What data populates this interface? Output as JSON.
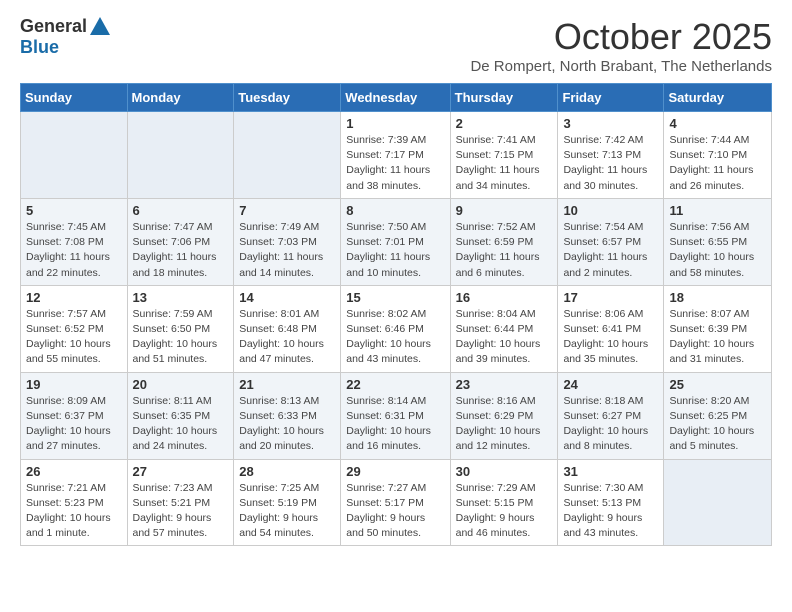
{
  "header": {
    "logo_general": "General",
    "logo_blue": "Blue",
    "month_title": "October 2025",
    "subtitle": "De Rompert, North Brabant, The Netherlands"
  },
  "weekdays": [
    "Sunday",
    "Monday",
    "Tuesday",
    "Wednesday",
    "Thursday",
    "Friday",
    "Saturday"
  ],
  "weeks": [
    [
      {
        "day": "",
        "info": ""
      },
      {
        "day": "",
        "info": ""
      },
      {
        "day": "",
        "info": ""
      },
      {
        "day": "1",
        "info": "Sunrise: 7:39 AM\nSunset: 7:17 PM\nDaylight: 11 hours\nand 38 minutes."
      },
      {
        "day": "2",
        "info": "Sunrise: 7:41 AM\nSunset: 7:15 PM\nDaylight: 11 hours\nand 34 minutes."
      },
      {
        "day": "3",
        "info": "Sunrise: 7:42 AM\nSunset: 7:13 PM\nDaylight: 11 hours\nand 30 minutes."
      },
      {
        "day": "4",
        "info": "Sunrise: 7:44 AM\nSunset: 7:10 PM\nDaylight: 11 hours\nand 26 minutes."
      }
    ],
    [
      {
        "day": "5",
        "info": "Sunrise: 7:45 AM\nSunset: 7:08 PM\nDaylight: 11 hours\nand 22 minutes."
      },
      {
        "day": "6",
        "info": "Sunrise: 7:47 AM\nSunset: 7:06 PM\nDaylight: 11 hours\nand 18 minutes."
      },
      {
        "day": "7",
        "info": "Sunrise: 7:49 AM\nSunset: 7:03 PM\nDaylight: 11 hours\nand 14 minutes."
      },
      {
        "day": "8",
        "info": "Sunrise: 7:50 AM\nSunset: 7:01 PM\nDaylight: 11 hours\nand 10 minutes."
      },
      {
        "day": "9",
        "info": "Sunrise: 7:52 AM\nSunset: 6:59 PM\nDaylight: 11 hours\nand 6 minutes."
      },
      {
        "day": "10",
        "info": "Sunrise: 7:54 AM\nSunset: 6:57 PM\nDaylight: 11 hours\nand 2 minutes."
      },
      {
        "day": "11",
        "info": "Sunrise: 7:56 AM\nSunset: 6:55 PM\nDaylight: 10 hours\nand 58 minutes."
      }
    ],
    [
      {
        "day": "12",
        "info": "Sunrise: 7:57 AM\nSunset: 6:52 PM\nDaylight: 10 hours\nand 55 minutes."
      },
      {
        "day": "13",
        "info": "Sunrise: 7:59 AM\nSunset: 6:50 PM\nDaylight: 10 hours\nand 51 minutes."
      },
      {
        "day": "14",
        "info": "Sunrise: 8:01 AM\nSunset: 6:48 PM\nDaylight: 10 hours\nand 47 minutes."
      },
      {
        "day": "15",
        "info": "Sunrise: 8:02 AM\nSunset: 6:46 PM\nDaylight: 10 hours\nand 43 minutes."
      },
      {
        "day": "16",
        "info": "Sunrise: 8:04 AM\nSunset: 6:44 PM\nDaylight: 10 hours\nand 39 minutes."
      },
      {
        "day": "17",
        "info": "Sunrise: 8:06 AM\nSunset: 6:41 PM\nDaylight: 10 hours\nand 35 minutes."
      },
      {
        "day": "18",
        "info": "Sunrise: 8:07 AM\nSunset: 6:39 PM\nDaylight: 10 hours\nand 31 minutes."
      }
    ],
    [
      {
        "day": "19",
        "info": "Sunrise: 8:09 AM\nSunset: 6:37 PM\nDaylight: 10 hours\nand 27 minutes."
      },
      {
        "day": "20",
        "info": "Sunrise: 8:11 AM\nSunset: 6:35 PM\nDaylight: 10 hours\nand 24 minutes."
      },
      {
        "day": "21",
        "info": "Sunrise: 8:13 AM\nSunset: 6:33 PM\nDaylight: 10 hours\nand 20 minutes."
      },
      {
        "day": "22",
        "info": "Sunrise: 8:14 AM\nSunset: 6:31 PM\nDaylight: 10 hours\nand 16 minutes."
      },
      {
        "day": "23",
        "info": "Sunrise: 8:16 AM\nSunset: 6:29 PM\nDaylight: 10 hours\nand 12 minutes."
      },
      {
        "day": "24",
        "info": "Sunrise: 8:18 AM\nSunset: 6:27 PM\nDaylight: 10 hours\nand 8 minutes."
      },
      {
        "day": "25",
        "info": "Sunrise: 8:20 AM\nSunset: 6:25 PM\nDaylight: 10 hours\nand 5 minutes."
      }
    ],
    [
      {
        "day": "26",
        "info": "Sunrise: 7:21 AM\nSunset: 5:23 PM\nDaylight: 10 hours\nand 1 minute."
      },
      {
        "day": "27",
        "info": "Sunrise: 7:23 AM\nSunset: 5:21 PM\nDaylight: 9 hours\nand 57 minutes."
      },
      {
        "day": "28",
        "info": "Sunrise: 7:25 AM\nSunset: 5:19 PM\nDaylight: 9 hours\nand 54 minutes."
      },
      {
        "day": "29",
        "info": "Sunrise: 7:27 AM\nSunset: 5:17 PM\nDaylight: 9 hours\nand 50 minutes."
      },
      {
        "day": "30",
        "info": "Sunrise: 7:29 AM\nSunset: 5:15 PM\nDaylight: 9 hours\nand 46 minutes."
      },
      {
        "day": "31",
        "info": "Sunrise: 7:30 AM\nSunset: 5:13 PM\nDaylight: 9 hours\nand 43 minutes."
      },
      {
        "day": "",
        "info": ""
      }
    ]
  ]
}
